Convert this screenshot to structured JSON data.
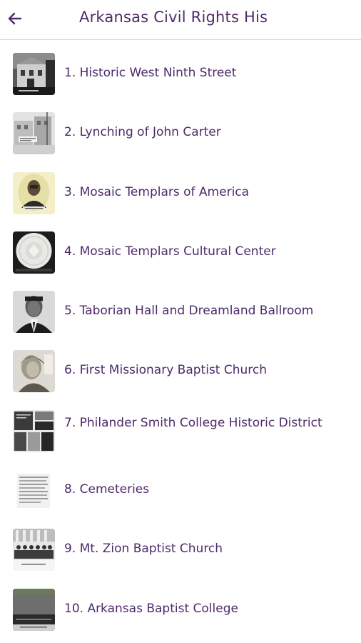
{
  "header": {
    "title": "Arkansas Civil Rights His",
    "back_icon": "arrow-left-icon"
  },
  "colors": {
    "accent": "#4e2a6a",
    "divider": "#d6d6d6",
    "background": "#ffffff"
  },
  "items": [
    {
      "label": "1. Historic West Ninth Street",
      "icon": "historic-building-photo"
    },
    {
      "label": "2. Lynching of John Carter",
      "icon": "street-photo"
    },
    {
      "label": "3. Mosaic Templars of America",
      "icon": "portrait-photo"
    },
    {
      "label": "4. Mosaic Templars Cultural Center",
      "icon": "seal-photo"
    },
    {
      "label": "5. Taborian Hall and Dreamland Ballroom",
      "icon": "portrait-photo"
    },
    {
      "label": "6. First Missionary Baptist Church",
      "icon": "portrait-photo"
    },
    {
      "label": "7. Philander Smith College Historic District",
      "icon": "newspaper-photo"
    },
    {
      "label": "8. Cemeteries",
      "icon": "document-photo"
    },
    {
      "label": "9. Mt. Zion Baptist Church",
      "icon": "group-photo"
    },
    {
      "label": "10. Arkansas Baptist College",
      "icon": "building-photo"
    }
  ]
}
